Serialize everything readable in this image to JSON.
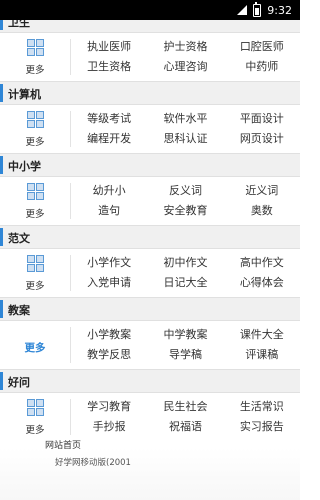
{
  "status_bar": {
    "time": "9:32"
  },
  "sections": [
    {
      "title": "卫生",
      "more_label": "更多",
      "more_style": "icon",
      "rows": [
        [
          "执业医师",
          "护士资格",
          "口腔医师"
        ],
        [
          "卫生资格",
          "心理咨询",
          "中药师"
        ]
      ]
    },
    {
      "title": "计算机",
      "more_label": "更多",
      "more_style": "icon",
      "rows": [
        [
          "等级考试",
          "软件水平",
          "平面设计"
        ],
        [
          "编程开发",
          "思科认证",
          "网页设计"
        ]
      ]
    },
    {
      "title": "中小学",
      "more_label": "更多",
      "more_style": "icon",
      "rows": [
        [
          "幼升小",
          "反义词",
          "近义词"
        ],
        [
          "造句",
          "安全教育",
          "奥数"
        ]
      ]
    },
    {
      "title": "范文",
      "more_label": "更多",
      "more_style": "icon",
      "rows": [
        [
          "小学作文",
          "初中作文",
          "高中作文"
        ],
        [
          "入党申请",
          "日记大全",
          "心得体会"
        ]
      ]
    },
    {
      "title": "教案",
      "more_label": "更多",
      "more_style": "text",
      "rows": [
        [
          "小学教案",
          "中学教案",
          "课件大全"
        ],
        [
          "教学反思",
          "导学稿",
          "评课稿"
        ]
      ]
    },
    {
      "title": "好问",
      "more_label": "更多",
      "more_style": "icon",
      "rows": [
        [
          "学习教育",
          "民生社会",
          "生活常识"
        ],
        [
          "手抄报",
          "祝福语",
          "实习报告"
        ]
      ]
    }
  ],
  "footer": {
    "home_link": "网站首页",
    "copyright": "好学网移动版(2001"
  }
}
